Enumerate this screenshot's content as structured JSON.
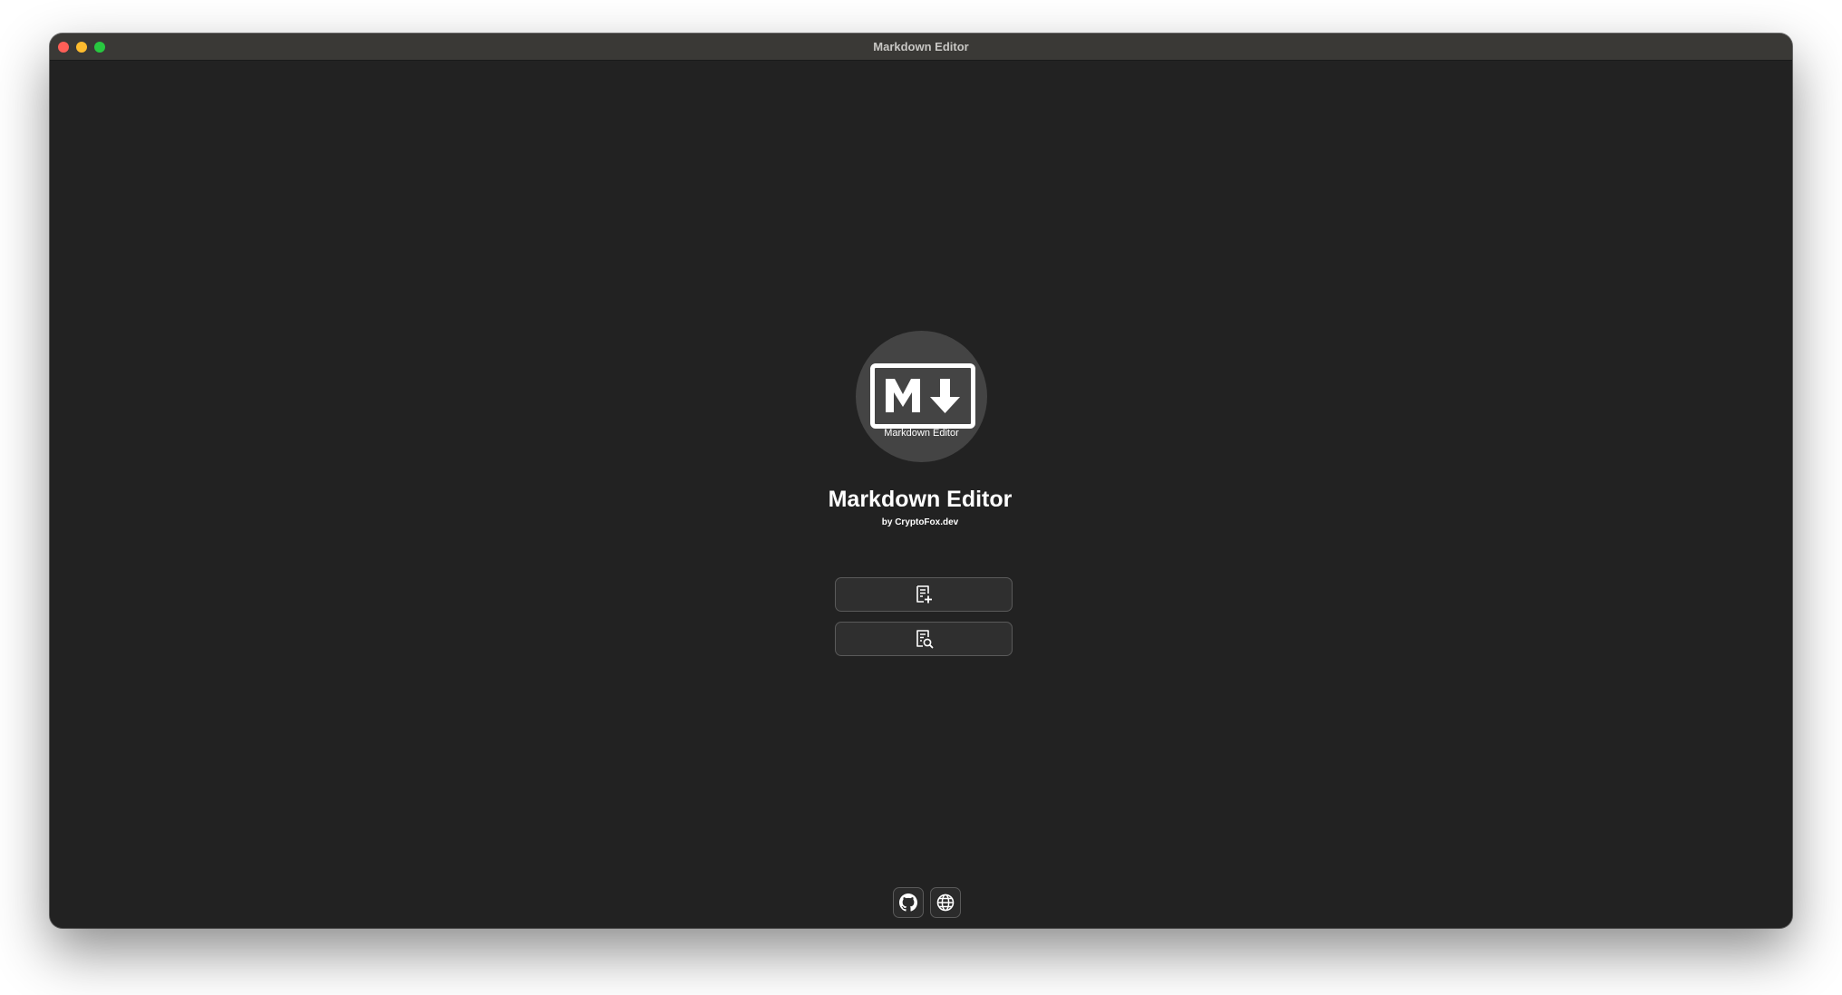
{
  "window": {
    "title": "Markdown Editor"
  },
  "logo": {
    "caption": "Markdown Editor",
    "icon": "markdown-logo-icon"
  },
  "app": {
    "name": "Markdown Editor",
    "byline": "by CryptoFox.dev"
  },
  "actions": [
    {
      "icon": "new-document-icon"
    },
    {
      "icon": "search-document-icon"
    }
  ],
  "footer": [
    {
      "icon": "github-icon"
    },
    {
      "icon": "globe-icon"
    }
  ],
  "colors": {
    "background": "#222222",
    "titlebar": "#3a3936",
    "logo_circle": "#444444",
    "close": "#fe5f57",
    "minimize": "#febc2e",
    "maximize": "#28c840"
  }
}
